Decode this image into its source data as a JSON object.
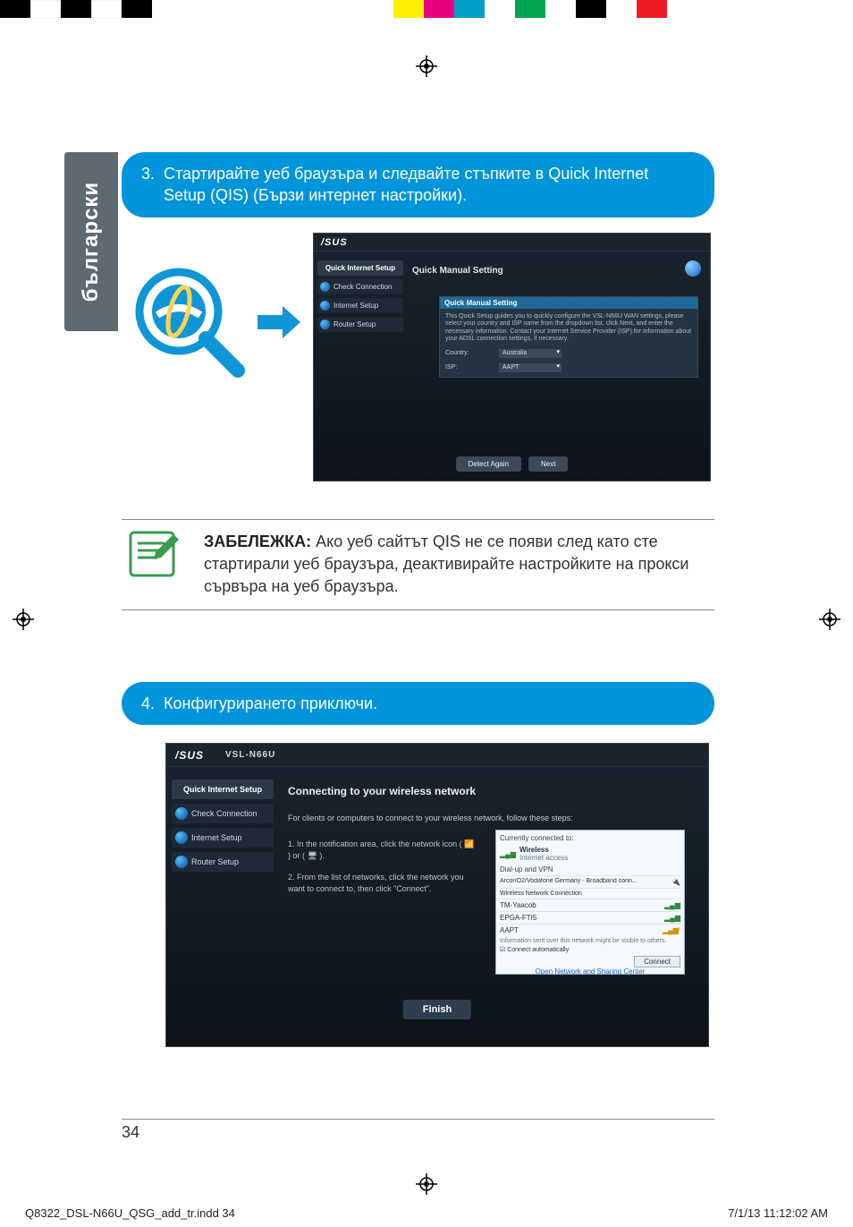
{
  "print": {
    "filename": "Q8322_DSL-N66U_QSG_add_tr.indd   34",
    "timestamp": "7/1/13   11:12:02 AM"
  },
  "side_tab": "български",
  "step3": {
    "num": "3.",
    "text": "Стартирайте уеб браузъра и следвайте стъпките в Quick Internet Setup (QIS) (Бързи интернет настройки)."
  },
  "step4": {
    "num": "4.",
    "text": "Конфигурирането приключи."
  },
  "note": {
    "label": "ЗАБЕЛЕЖКА:",
    "text": " Ако уеб сайтът QIS не се появи след като сте стартирали уеб браузъра, деактивирайте настройките на прокси сървъра на уеб браузъра."
  },
  "shot1": {
    "logo": "/SUS",
    "title": "Quick Manual Setting",
    "side_hdr": "Quick Internet Setup",
    "side_items": [
      "Check Connection",
      "Internet Setup",
      "Router Setup"
    ],
    "panel_hdr": "Quick Manual Setting",
    "panel_desc": "This Quick Setup guides you to quickly configure the VSL-N66U WAN settings, please select your country and ISP name from the dropdown list, click Next, and enter the necessary information. Contact your Internet Service Provider (ISP) for information about your ADSL connection settings, if necessary.",
    "country_lbl": "Country:",
    "country_val": "Australia",
    "isp_lbl": "ISP:",
    "isp_val": "AAPT",
    "btn_detect": "Detect Again",
    "btn_next": "Next"
  },
  "shot2": {
    "logo": "/SUS",
    "model": "VSL-N66U",
    "side_hdr": "Quick Internet Setup",
    "side_items": [
      "Check Connection",
      "Internet Setup",
      "Router Setup"
    ],
    "h2": "Connecting to your wireless network",
    "sub": "For clients or computers to connect to your wireless network, follow these steps:",
    "step1": "1. In the notification area, click the network icon ( 📶 ) or ( 🖥 ).",
    "step2": "2. From the list of networks, click the network you want to connect to, then click \"Connect\".",
    "wifi": {
      "currently": "Currently connected to:",
      "net_name": "Wireless",
      "net_sub": "Internet access",
      "section": "Dial-up and VPN",
      "r1": "Arcor/O2/Vodafone Germany - Broadband conn...",
      "r2": "Wireless Network Connection",
      "r3": "TM-Yaacob",
      "r4": "EPGA-FTI5",
      "r5": "AAPT",
      "info": "Information sent over this network might be visible to others.",
      "auto": "☑ Connect automatically",
      "conn": "Connect",
      "link": "Open Network and Sharing Center"
    },
    "btn_finish": "Finish"
  },
  "page_num": "34"
}
